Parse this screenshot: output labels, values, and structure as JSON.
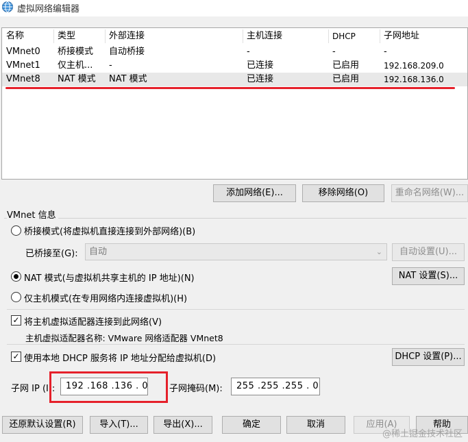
{
  "window": {
    "title": "虚拟网络编辑器",
    "icon": "network-globe-icon"
  },
  "table": {
    "headers": [
      "名称",
      "类型",
      "外部连接",
      "主机连接",
      "DHCP",
      "子网地址"
    ],
    "rows": [
      [
        "VMnet0",
        "桥接模式",
        "自动桥接",
        "-",
        "-",
        "-"
      ],
      [
        "VMnet1",
        "仅主机...",
        "-",
        "已连接",
        "已启用",
        "192.168.209.0"
      ],
      [
        "VMnet8",
        "NAT 模式",
        "NAT 模式",
        "已连接",
        "已启用",
        "192.168.136.0"
      ]
    ],
    "selected_row": 2,
    "annotation_color": "#e5202a"
  },
  "list_buttons": {
    "add": "添加网络(E)...",
    "remove": "移除网络(O)",
    "rename": "重命名网络(W)..."
  },
  "vmnet_info": {
    "title": "VMnet 信息",
    "bridge_label": "桥接模式(将虚拟机直接连接到外部网络)(B)",
    "bridged_to_label": "已桥接至(G):",
    "bridged_to_value": "自动",
    "auto_settings": "自动设置(U)...",
    "nat_label": "NAT 模式(与虚拟机共享主机的 IP 地址)(N)",
    "nat_settings": "NAT 设置(S)...",
    "hostonly_label": "仅主机模式(在专用网络内连接虚拟机)(H)",
    "selected_mode": "nat",
    "connect_adapter_label": "将主机虚拟适配器连接到此网络(V)",
    "connect_adapter_checked": true,
    "adapter_name_label": "主机虚拟适配器名称: VMware 网络适配器 VMnet8",
    "dhcp_label": "使用本地 DHCP 服务将 IP 地址分配给虚拟机(D)",
    "dhcp_checked": true,
    "dhcp_settings": "DHCP 设置(P)...",
    "subnet_ip_label": "子网 IP (I):",
    "subnet_ip_value": "192 .168 .136 . 0",
    "subnet_mask_label": "子网掩码(M):",
    "subnet_mask_value": "255 .255 .255 . 0"
  },
  "footer": {
    "restore": "还原默认设置(R)",
    "import": "导入(T)...",
    "export": "导出(X)...",
    "ok": "确定",
    "cancel": "取消",
    "apply": "应用(A)",
    "help": "帮助"
  },
  "watermark": "@稀土掘金技术社区"
}
